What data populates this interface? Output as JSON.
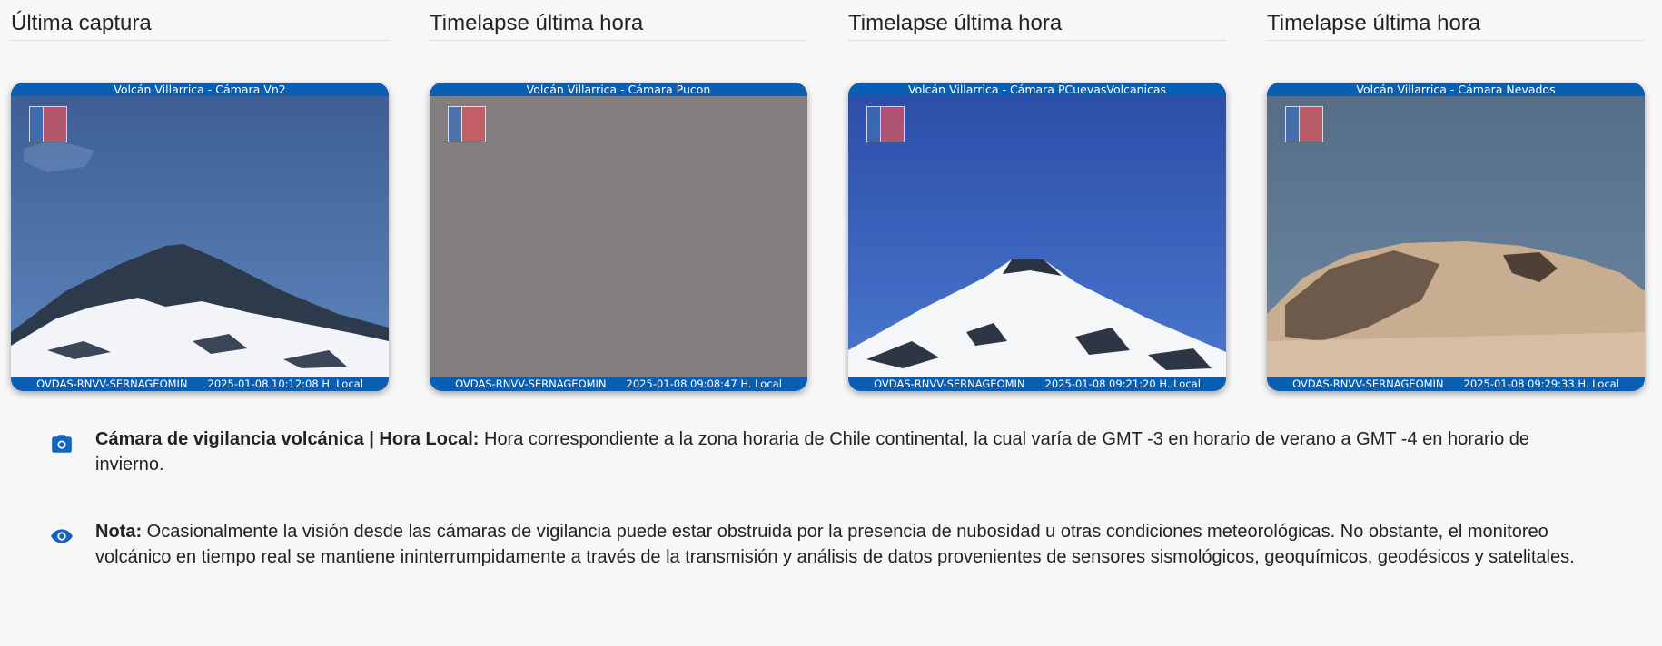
{
  "cameras": [
    {
      "heading": "Última captura",
      "name": "Volcán Villarrica - Cámara Vn2",
      "source": "OVDAS-RNVV-SERNAGEOMIN",
      "timestamp": "2025-01-08 10:12:08 H. Local",
      "scene": "snowy-peak-left"
    },
    {
      "heading": "Timelapse última hora",
      "name": "Volcán Villarrica - Cámara Pucon",
      "source": "OVDAS-RNVV-SERNAGEOMIN",
      "timestamp": "2025-01-08 09:08:47 H. Local",
      "scene": "overcast"
    },
    {
      "heading": "Timelapse última hora",
      "name": "Volcán Villarrica - Cámara PCuevasVolcanicas",
      "source": "OVDAS-RNVV-SERNAGEOMIN",
      "timestamp": "2025-01-08 09:21:20 H. Local",
      "scene": "snowy-peak-center"
    },
    {
      "heading": "Timelapse última hora",
      "name": "Volcán Villarrica - Cámara Nevados",
      "source": "OVDAS-RNVV-SERNAGEOMIN",
      "timestamp": "2025-01-08 09:29:33 H. Local",
      "scene": "crater-closeup"
    }
  ],
  "notes": [
    {
      "icon": "camera-icon",
      "bold": "Cámara de vigilancia volcánica | Hora Local:",
      "text": " Hora correspondiente a la zona horaria de Chile continental,  la cual varía de GMT -3 en horario de verano a GMT -4 en horario de invierno."
    },
    {
      "icon": "eye-icon",
      "bold": "Nota:",
      "text": " Ocasionalmente la visión desde las cámaras de vigilancia puede estar obstruida por la presencia de nubosidad u otras condiciones meteorológicas. No obstante, el monitoreo volcánico en tiempo real se mantiene ininterrumpidamente a través de la transmisión y análisis de datos provenientes de sensores sismológicos, geoquímicos, geodésicos y satelitales."
    }
  ],
  "colors": {
    "accent": "#0b5fb3",
    "icon": "#1565c0"
  }
}
